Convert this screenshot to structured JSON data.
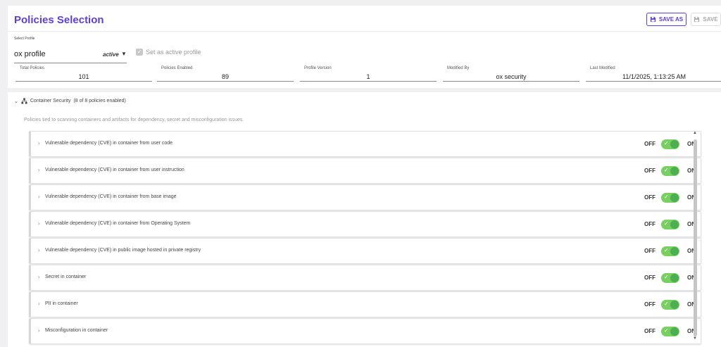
{
  "header": {
    "title": "Policies Selection",
    "save_as_label": "SAVE AS",
    "save_label": "SAVE",
    "accent": "#5b3fd6"
  },
  "profile": {
    "select_label": "Select Profile",
    "value": "ox profile",
    "status": "active",
    "set_active_label": "Set as active profile",
    "set_active_checked": true
  },
  "stats": [
    {
      "label": "Total Policies",
      "value": "101"
    },
    {
      "label": "Policies Enabled",
      "value": "89"
    },
    {
      "label": "Profile Version",
      "value": "1"
    },
    {
      "label": "Modified By",
      "value": "ox security"
    },
    {
      "label": "Last Modified",
      "value": "11/1/2025, 1:13:25 AM"
    }
  ],
  "section": {
    "title": "Container Security",
    "count": "(8 of 8 policies enabled)",
    "description": "Policies tied to scanning containers and artifacts for dependency, secret and misconfiguration issues."
  },
  "toggle_labels": {
    "off": "OFF",
    "on": "ON"
  },
  "policies": [
    {
      "label": "Vulnerable dependency (CVE) in container from user code",
      "enabled": true
    },
    {
      "label": "Vulnerable dependency (CVE) in container from user instruction",
      "enabled": true
    },
    {
      "label": "Vulnerable dependency (CVE) in container from base image",
      "enabled": true
    },
    {
      "label": "Vulnerable dependency (CVE) in container from Operating System",
      "enabled": true
    },
    {
      "label": "Vulnerable dependency (CVE) in public image hosted in private registry",
      "enabled": true
    },
    {
      "label": "Secret in container",
      "enabled": true
    },
    {
      "label": "PII in container",
      "enabled": true
    },
    {
      "label": "Misconfiguration in container",
      "enabled": true
    }
  ],
  "icons": {
    "save_as": "save-icon",
    "save": "save-icon",
    "section": "sitemap-icon",
    "toggle_check": "check-icon"
  },
  "colors": {
    "toggle_on": "#7acf63",
    "toggle_knob": "#4caf50"
  }
}
